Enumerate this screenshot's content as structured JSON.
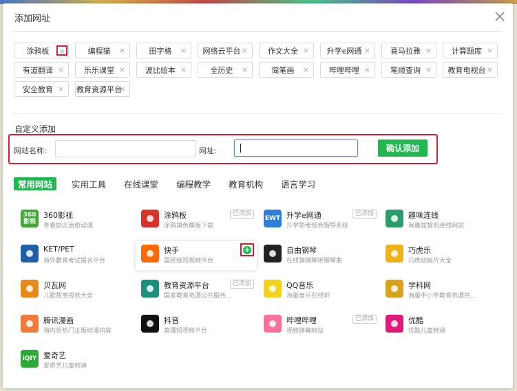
{
  "dialog": {
    "title": "添加网址",
    "close_icon": "close-icon"
  },
  "tags": [
    {
      "label": "涂鸦板",
      "highlight": true
    },
    {
      "label": "编程猫"
    },
    {
      "label": "田字格"
    },
    {
      "label": "网络云平台"
    },
    {
      "label": "作文大全"
    },
    {
      "label": "升学e网通"
    },
    {
      "label": "喜马拉雅"
    },
    {
      "label": "计算题库"
    },
    {
      "label": "有道翻译"
    },
    {
      "label": "乐乐课堂"
    },
    {
      "label": "波比绘本"
    },
    {
      "label": "全历史"
    },
    {
      "label": "简笔画"
    },
    {
      "label": "哔哩哔哩"
    },
    {
      "label": "笔顺查询"
    },
    {
      "label": "教育电视台"
    },
    {
      "label": "安全教育"
    },
    {
      "label": "教育资源平台"
    }
  ],
  "tag_remove_glyph": "×",
  "custom": {
    "title": "自定义添加",
    "name_label": "网站名称:",
    "url_label": "网址:",
    "confirm_label": "确认添加"
  },
  "tabs": [
    "常用网站",
    "实用工具",
    "在线课堂",
    "编程教学",
    "教育机构",
    "语言学习"
  ],
  "added_label": "已添加",
  "add_glyph": "+",
  "sites": [
    {
      "name": "360影视",
      "desc": "青春励志治愈动漫",
      "icon": "360-icon",
      "color": "#3fa736",
      "text": "360\n影视"
    },
    {
      "name": "涂鸦板",
      "desc": "涂鸦填色模板下载",
      "icon": "car-icon",
      "color": "#d8332b",
      "added": true
    },
    {
      "name": "升学e网通",
      "desc": "升学助考综合指导系统",
      "icon": "ewt-icon",
      "color": "#2f7ed8",
      "text": "EWT",
      "added": true
    },
    {
      "name": "趣味连线",
      "desc": "有趣益智的连线网站",
      "icon": "grid-icon",
      "color": "#2a9d6a"
    },
    {
      "name": "KET/PET",
      "desc": "海外教育考试报名平台",
      "icon": "emblem-icon",
      "color": "#1f5fa8"
    },
    {
      "name": "快手",
      "desc": "国民级短视频平台",
      "icon": "kuaishou-icon",
      "color": "#ff6a00",
      "hover": true
    },
    {
      "name": "自由钢琴",
      "desc": "在线弹钢琴听钢琴曲",
      "icon": "piano-icon",
      "color": "#222222"
    },
    {
      "name": "巧虎乐",
      "desc": "巧虎动画片大全",
      "icon": "tiger-icon",
      "color": "#f0b21a"
    },
    {
      "name": "贝瓦网",
      "desc": "儿歌故事视频大全",
      "icon": "bear-icon",
      "color": "#e88a1a"
    },
    {
      "name": "教育资源平台",
      "desc": "国家教育资源公共服务...",
      "icon": "book-icon",
      "color": "#1a8f7a",
      "added": true
    },
    {
      "name": "QQ音乐",
      "desc": "海量音乐在线听",
      "icon": "music-icon",
      "color": "#f5d21a"
    },
    {
      "name": "学科网",
      "desc": "海量中小学教育资源共...",
      "icon": "scholar-icon",
      "color": "#d8a21a"
    },
    {
      "name": "腾讯漫画",
      "desc": "海内外热门正版动漫内容",
      "icon": "comic-icon",
      "color": "#f07a3a"
    },
    {
      "name": "抖音",
      "desc": "直播短视频平台",
      "icon": "douyin-icon",
      "color": "#111111"
    },
    {
      "name": "哔哩哔哩",
      "desc": "视频弹幕网站",
      "icon": "bilibili-icon",
      "color": "#fb7299",
      "added": true
    },
    {
      "name": "优酷",
      "desc": "优酷儿童频道",
      "icon": "youku-icon",
      "color": "#e0197d"
    },
    {
      "name": "爱奇艺",
      "desc": "爱奇艺儿童频道",
      "icon": "iqiyi-icon",
      "color": "#2ea836",
      "text": "iQIY"
    }
  ]
}
